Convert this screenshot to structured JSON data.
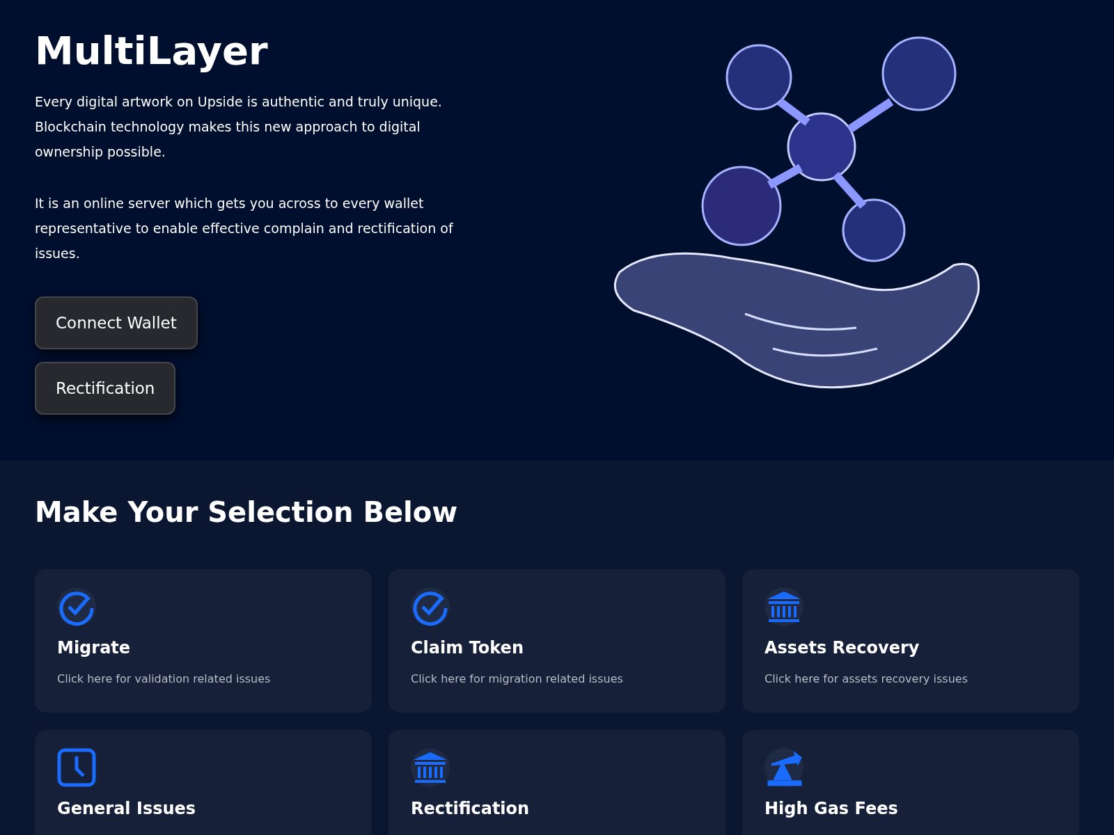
{
  "hero": {
    "title": "MultiLayer",
    "paragraphs": [
      "Every digital artwork on Upside is authentic and truly unique. Blockchain technology makes this new approach to digital ownership possible.",
      "It is an online server which gets you across to every wallet representative to enable effective complain and rectification of issues."
    ],
    "buttons": [
      "Connect Wallet",
      "Rectification"
    ]
  },
  "selection": {
    "heading": "Make Your Selection Below",
    "cards": [
      {
        "kind": "check",
        "title": "Migrate",
        "description": "Click here for validation related issues"
      },
      {
        "kind": "check",
        "title": "Claim Token",
        "description": "Click here for migration related issues"
      },
      {
        "kind": "bank",
        "title": "Assets Recovery",
        "description": "Click here for assets recovery issues"
      },
      {
        "kind": "clock",
        "title": "General Issues"
      },
      {
        "kind": "bank",
        "title": "Rectification"
      },
      {
        "kind": "pump",
        "title": "High Gas Fees"
      }
    ]
  }
}
